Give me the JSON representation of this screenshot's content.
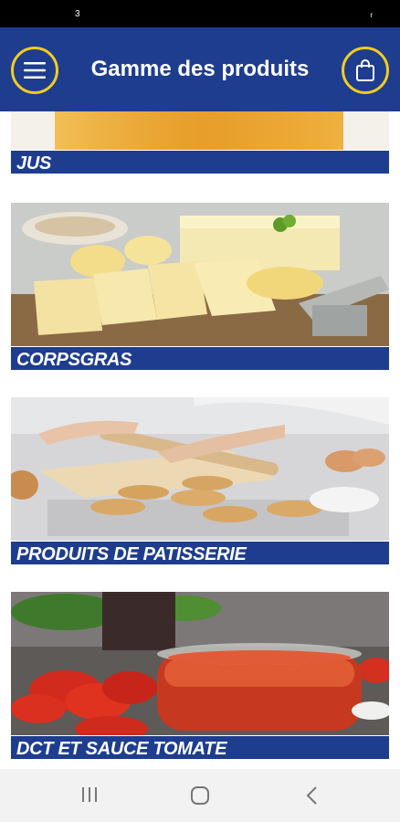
{
  "status": {
    "left": "3",
    "right": "r"
  },
  "header": {
    "title": "Gamme des produits",
    "menu_icon": "hamburger-icon",
    "cart_icon": "shopping-bag-icon"
  },
  "categories": [
    {
      "label": "JUS"
    },
    {
      "label": "CORPSGRAS"
    },
    {
      "label": "PRODUITS DE PATISSERIE"
    },
    {
      "label": "DCT ET SAUCE TOMATE"
    }
  ],
  "colors": {
    "primary": "#1e3d8f",
    "accent": "#f2cc1e"
  },
  "navbar": {
    "recent": "recent-apps-icon",
    "home": "home-icon",
    "back": "back-icon"
  }
}
